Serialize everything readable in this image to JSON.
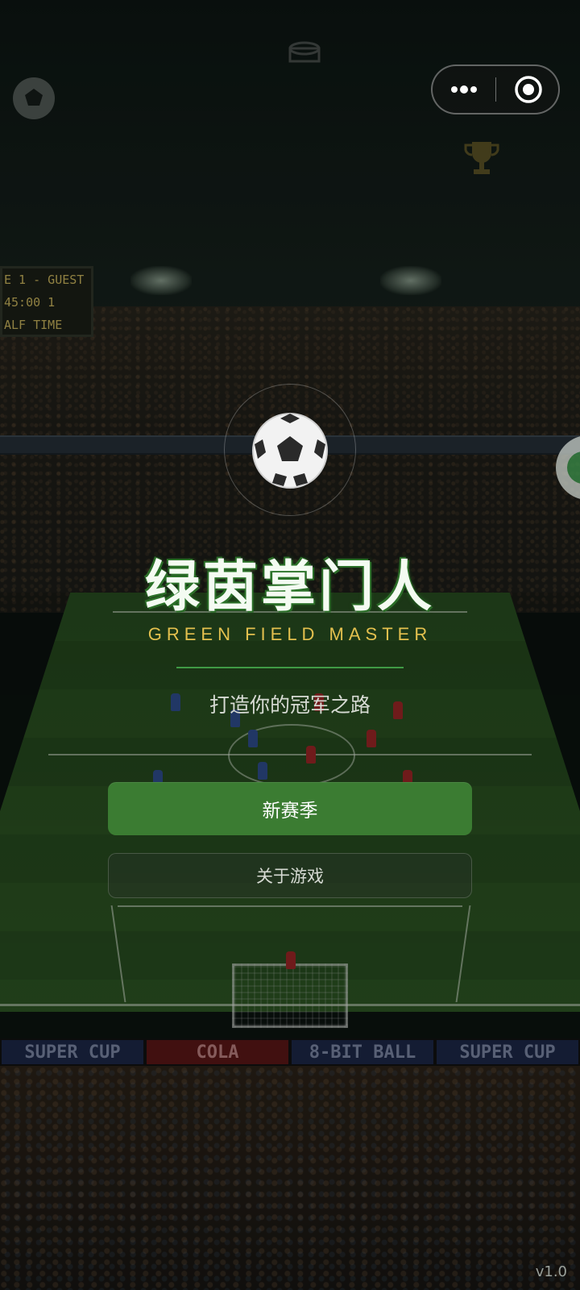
{
  "app": {
    "title": "绿茵掌门人",
    "subtitle_en": "GREEN FIELD MASTER",
    "slogan": "打造你的冠军之路",
    "version": "v1.0"
  },
  "actions": {
    "new_season": "新赛季",
    "about": "关于游戏"
  },
  "background": {
    "scoreboard": [
      "E 1 - GUEST",
      "45:00  1",
      "ALF TIME"
    ],
    "ad_boards": [
      "SUPER CUP",
      "COLA",
      "8-BIT BALL",
      "SUPER CUP"
    ]
  },
  "capsule": {
    "more_icon": "more-dots-icon",
    "close_icon": "target-close-icon"
  },
  "colors": {
    "primary_button": "#3b7c32",
    "accent_yellow": "#e3c04e",
    "divider_green": "#3f9a45"
  }
}
